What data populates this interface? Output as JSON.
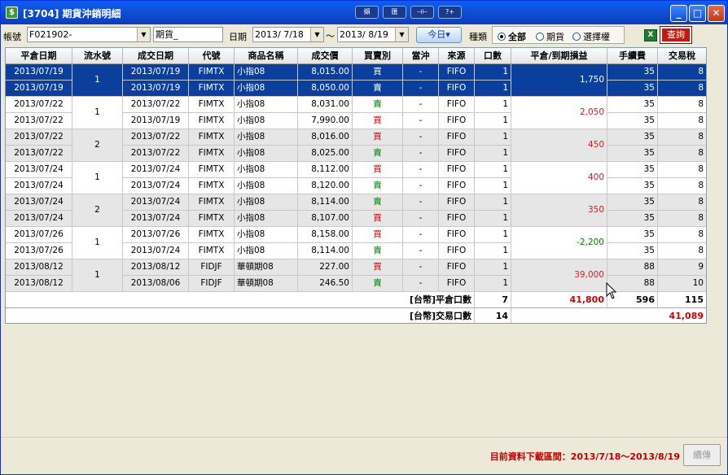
{
  "window": {
    "title": "[3704] 期貨沖銷明細",
    "tools": [
      "擷",
      "匯",
      "⊣⊢",
      "?+"
    ],
    "controls": {
      "minimize": "_",
      "maximize": "□",
      "close": "✕"
    }
  },
  "toolbar": {
    "account_label": "帳號",
    "account_value": "F021902-",
    "category_value": "期貨_",
    "date_label": "日期",
    "date_from": "2013/ 7/18",
    "date_sep": "～",
    "date_to": "2013/ 8/19",
    "today_button": "今日▾",
    "type_label": "種類",
    "type_options": [
      "全部",
      "期貨",
      "選擇權"
    ],
    "type_selected": "全部",
    "excel_icon": "X",
    "query_button": "查詢"
  },
  "table": {
    "headers": [
      "平倉日期",
      "流水號",
      "成交日期",
      "代號",
      "商品名稱",
      "成交價",
      "買賣別",
      "當沖",
      "來源",
      "口數",
      "平倉/到期損益",
      "手續費",
      "交易稅"
    ],
    "groups": [
      {
        "serial": "1",
        "pl": "1,750",
        "pl_sign": "pos",
        "selected": true,
        "shade": false,
        "rows": [
          {
            "close_date": "2013/07/19",
            "trade_date": "2013/07/19",
            "code": "FIMTX",
            "name": "小指08",
            "price": "8,015.00",
            "side": "買",
            "day_trade": "-",
            "source": "FIFO",
            "qty": "1",
            "fee": "35",
            "tax": "8"
          },
          {
            "close_date": "2013/07/19",
            "trade_date": "2013/07/19",
            "code": "FIMTX",
            "name": "小指08",
            "price": "8,050.00",
            "side": "賣",
            "day_trade": "-",
            "source": "FIFO",
            "qty": "1",
            "fee": "35",
            "tax": "8"
          }
        ]
      },
      {
        "serial": "1",
        "pl": "2,050",
        "pl_sign": "pos",
        "selected": false,
        "shade": false,
        "rows": [
          {
            "close_date": "2013/07/22",
            "trade_date": "2013/07/22",
            "code": "FIMTX",
            "name": "小指08",
            "price": "8,031.00",
            "side": "賣",
            "day_trade": "-",
            "source": "FIFO",
            "qty": "1",
            "fee": "35",
            "tax": "8"
          },
          {
            "close_date": "2013/07/22",
            "trade_date": "2013/07/19",
            "code": "FIMTX",
            "name": "小指08",
            "price": "7,990.00",
            "side": "買",
            "day_trade": "-",
            "source": "FIFO",
            "qty": "1",
            "fee": "35",
            "tax": "8"
          }
        ]
      },
      {
        "serial": "2",
        "pl": "450",
        "pl_sign": "pos",
        "selected": false,
        "shade": true,
        "rows": [
          {
            "close_date": "2013/07/22",
            "trade_date": "2013/07/22",
            "code": "FIMTX",
            "name": "小指08",
            "price": "8,016.00",
            "side": "買",
            "day_trade": "-",
            "source": "FIFO",
            "qty": "1",
            "fee": "35",
            "tax": "8"
          },
          {
            "close_date": "2013/07/22",
            "trade_date": "2013/07/22",
            "code": "FIMTX",
            "name": "小指08",
            "price": "8,025.00",
            "side": "賣",
            "day_trade": "-",
            "source": "FIFO",
            "qty": "1",
            "fee": "35",
            "tax": "8"
          }
        ]
      },
      {
        "serial": "1",
        "pl": "400",
        "pl_sign": "pos",
        "selected": false,
        "shade": false,
        "rows": [
          {
            "close_date": "2013/07/24",
            "trade_date": "2013/07/24",
            "code": "FIMTX",
            "name": "小指08",
            "price": "8,112.00",
            "side": "買",
            "day_trade": "-",
            "source": "FIFO",
            "qty": "1",
            "fee": "35",
            "tax": "8"
          },
          {
            "close_date": "2013/07/24",
            "trade_date": "2013/07/24",
            "code": "FIMTX",
            "name": "小指08",
            "price": "8,120.00",
            "side": "賣",
            "day_trade": "-",
            "source": "FIFO",
            "qty": "1",
            "fee": "35",
            "tax": "8"
          }
        ]
      },
      {
        "serial": "2",
        "pl": "350",
        "pl_sign": "pos",
        "selected": false,
        "shade": true,
        "rows": [
          {
            "close_date": "2013/07/24",
            "trade_date": "2013/07/24",
            "code": "FIMTX",
            "name": "小指08",
            "price": "8,114.00",
            "side": "賣",
            "day_trade": "-",
            "source": "FIFO",
            "qty": "1",
            "fee": "35",
            "tax": "8"
          },
          {
            "close_date": "2013/07/24",
            "trade_date": "2013/07/24",
            "code": "FIMTX",
            "name": "小指08",
            "price": "8,107.00",
            "side": "買",
            "day_trade": "-",
            "source": "FIFO",
            "qty": "1",
            "fee": "35",
            "tax": "8"
          }
        ]
      },
      {
        "serial": "1",
        "pl": "-2,200",
        "pl_sign": "neg",
        "selected": false,
        "shade": false,
        "rows": [
          {
            "close_date": "2013/07/26",
            "trade_date": "2013/07/26",
            "code": "FIMTX",
            "name": "小指08",
            "price": "8,158.00",
            "side": "買",
            "day_trade": "-",
            "source": "FIFO",
            "qty": "1",
            "fee": "35",
            "tax": "8"
          },
          {
            "close_date": "2013/07/26",
            "trade_date": "2013/07/24",
            "code": "FIMTX",
            "name": "小指08",
            "price": "8,114.00",
            "side": "賣",
            "day_trade": "-",
            "source": "FIFO",
            "qty": "1",
            "fee": "35",
            "tax": "8"
          }
        ]
      },
      {
        "serial": "1",
        "pl": "39,000",
        "pl_sign": "pos",
        "selected": false,
        "shade": true,
        "rows": [
          {
            "close_date": "2013/08/12",
            "trade_date": "2013/08/12",
            "code": "FIDJF",
            "name": "華頓期08",
            "price": "227.00",
            "side": "買",
            "day_trade": "-",
            "source": "FIFO",
            "qty": "1",
            "fee": "88",
            "tax": "9"
          },
          {
            "close_date": "2013/08/12",
            "trade_date": "2013/08/06",
            "code": "FIDJF",
            "name": "華頓期08",
            "price": "246.50",
            "side": "賣",
            "day_trade": "-",
            "source": "FIFO",
            "qty": "1",
            "fee": "88",
            "tax": "10"
          }
        ]
      }
    ],
    "summary": {
      "close_label": "[台幣]平倉口數",
      "close_qty": "7",
      "total_pl": "41,800",
      "total_fee": "596",
      "total_tax": "115",
      "trade_label": "[台幣]交易口數",
      "trade_qty": "14",
      "net_total": "41,089"
    }
  },
  "footer": {
    "period_text": "目前資料下載區間：2013/7/18～2013/8/19",
    "continue_button": "續傳"
  }
}
